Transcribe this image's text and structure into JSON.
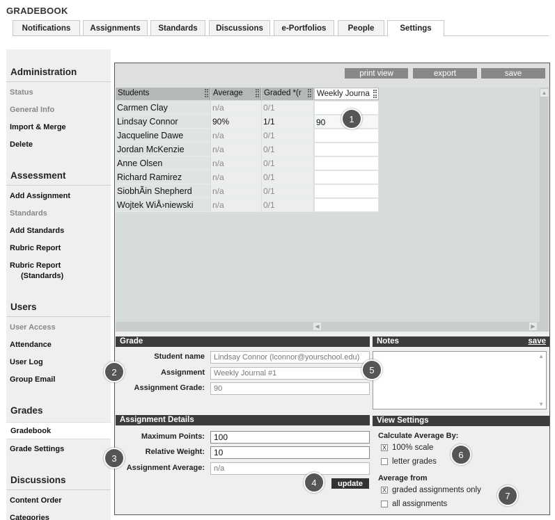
{
  "app": {
    "title": "GRADEBOOK"
  },
  "tabs": [
    {
      "label": "Notifications"
    },
    {
      "label": "Assignments"
    },
    {
      "label": "Standards"
    },
    {
      "label": "Discussions"
    },
    {
      "label": "e-Portfolios"
    },
    {
      "label": "People"
    },
    {
      "label": "Settings",
      "active": true
    }
  ],
  "sidebar": {
    "administration": {
      "heading": "Administration",
      "items": [
        "Status",
        "General Info",
        "Import & Merge",
        "Delete"
      ]
    },
    "assessment": {
      "heading": "Assessment",
      "items": [
        "Add Assignment",
        "Standards",
        "Add Standards",
        "Rubric Report",
        "Rubric Report",
        "(Standards)"
      ]
    },
    "users": {
      "heading": "Users",
      "items": [
        "User Access",
        "Attendance",
        "User Log",
        "Group Email"
      ]
    },
    "grades": {
      "heading": "Grades",
      "items": [
        "Gradebook",
        "Grade Settings"
      ]
    },
    "discussions": {
      "heading": "Discussions",
      "items": [
        "Content Order",
        "Categories"
      ]
    }
  },
  "toolbar": {
    "print": "print view",
    "export": "export",
    "save": "save"
  },
  "grid": {
    "columns": [
      "Students",
      "Average",
      "Graded *(r",
      "Weekly Journa"
    ],
    "rows": [
      {
        "name": "Carmen Clay",
        "average": "n/a",
        "graded": "0/1",
        "weekly": ""
      },
      {
        "name": "Lindsay Connor",
        "average": "90%",
        "graded": "1/1",
        "weekly": "90"
      },
      {
        "name": "Jacqueline Dawe",
        "average": "n/a",
        "graded": "0/1",
        "weekly": ""
      },
      {
        "name": "Jordan McKenzie",
        "average": "n/a",
        "graded": "0/1",
        "weekly": ""
      },
      {
        "name": "Anne Olsen",
        "average": "n/a",
        "graded": "0/1",
        "weekly": ""
      },
      {
        "name": "Richard Ramirez",
        "average": "n/a",
        "graded": "0/1",
        "weekly": ""
      },
      {
        "name": "SiobhÃin Shepherd",
        "average": "n/a",
        "graded": "0/1",
        "weekly": ""
      },
      {
        "name": "Wojtek WiÅ›niewski",
        "average": "n/a",
        "graded": "0/1",
        "weekly": ""
      }
    ]
  },
  "grade": {
    "heading": "Grade",
    "student_label": "Student name",
    "student_value": "Lindsay Connor (lconnor@yourschool.edu)",
    "assignment_label": "Assignment",
    "assignment_value": "Weekly Journal #1",
    "grade_label": "Assignment Grade:",
    "grade_value": "90"
  },
  "notes": {
    "heading": "Notes",
    "save": "save"
  },
  "details": {
    "heading": "Assignment Details",
    "max_label": "Maximum Points:",
    "max_value": "100",
    "weight_label": "Relative Weight:",
    "weight_value": "10",
    "avg_label": "Assignment Average:",
    "avg_value": "n/a",
    "update": "update"
  },
  "view": {
    "heading": "View Settings",
    "calc_label": "Calculate Average By:",
    "opt_scale": "100% scale",
    "opt_letter": "letter grades",
    "from_label": "Average from",
    "opt_graded": "graded assignments only",
    "opt_all": "all assignments",
    "mark": "X"
  },
  "callouts": [
    "1",
    "2",
    "3",
    "4",
    "5",
    "6",
    "7"
  ]
}
